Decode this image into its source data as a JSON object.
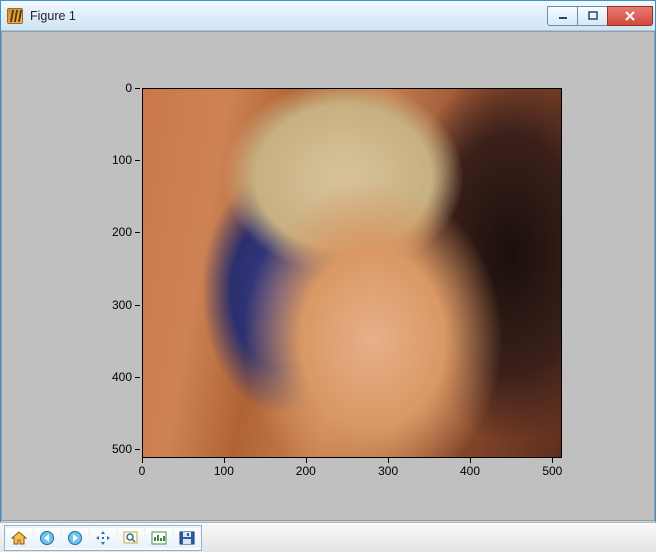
{
  "window": {
    "title": "Figure 1"
  },
  "axes": {
    "x_ticks": [
      "0",
      "100",
      "200",
      "300",
      "400",
      "500"
    ],
    "y_ticks": [
      "0",
      "100",
      "200",
      "300",
      "400",
      "500"
    ],
    "x_range": [
      0,
      512
    ],
    "y_range": [
      0,
      512
    ]
  },
  "toolbar": {
    "buttons": [
      {
        "name": "home",
        "label": "Home"
      },
      {
        "name": "back",
        "label": "Back"
      },
      {
        "name": "forward",
        "label": "Forward"
      },
      {
        "name": "pan",
        "label": "Pan"
      },
      {
        "name": "zoom",
        "label": "Zoom"
      },
      {
        "name": "subplots",
        "label": "Configure subplots"
      },
      {
        "name": "save",
        "label": "Save"
      }
    ]
  },
  "image": {
    "description": "512×512 color photograph displayed via imshow"
  }
}
